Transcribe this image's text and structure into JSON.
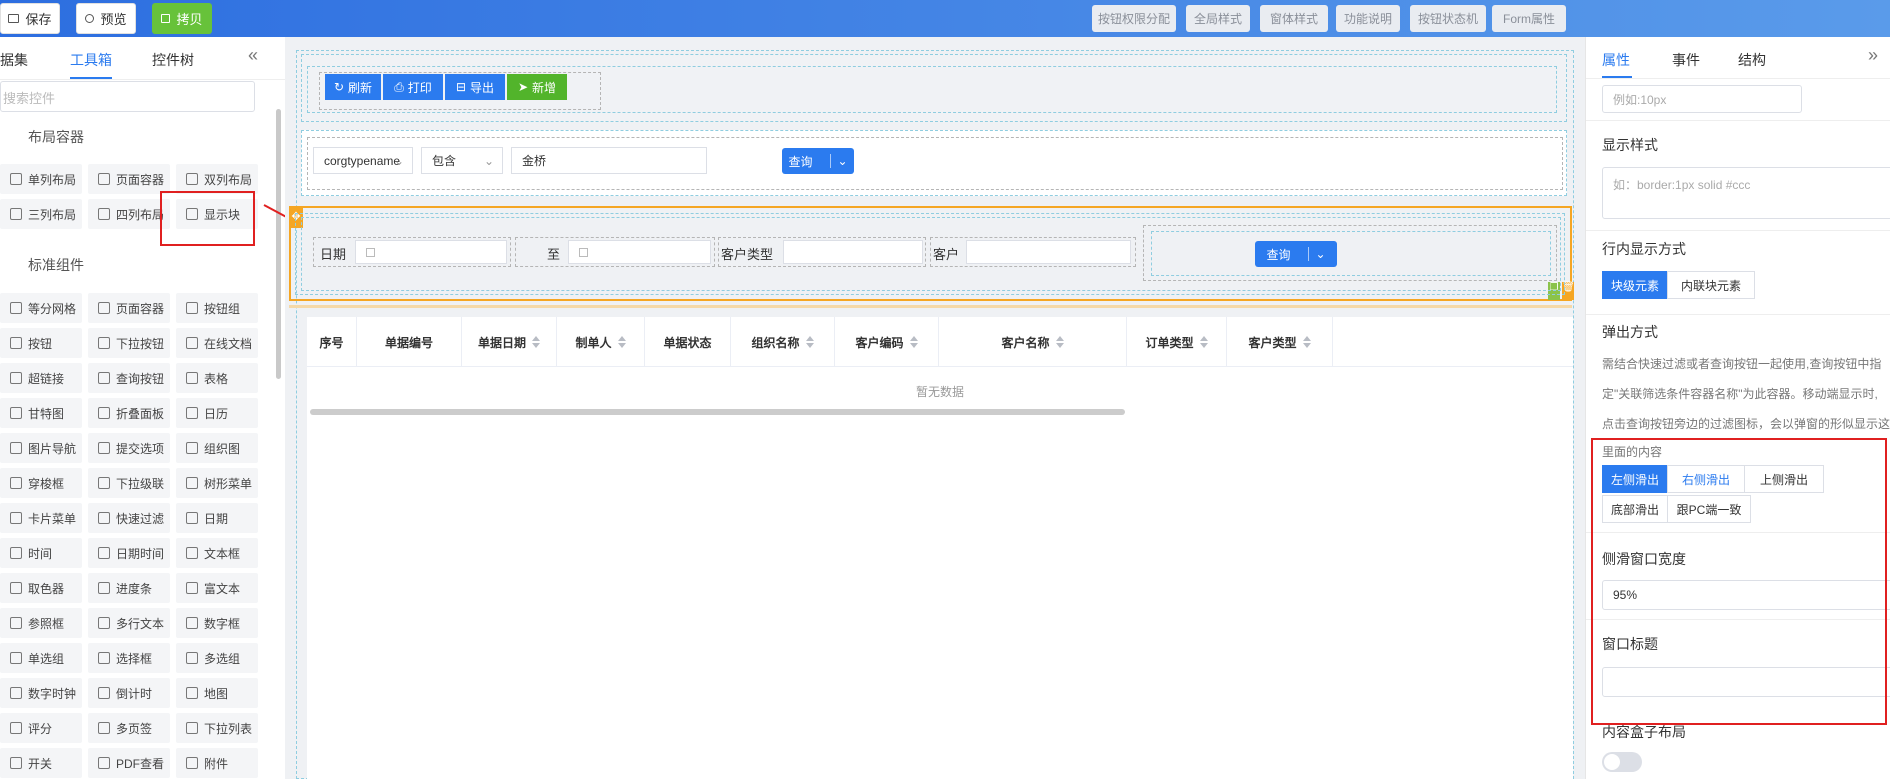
{
  "toolbar": {
    "save": "保存",
    "preview": "预览",
    "copy": "拷贝",
    "right_buttons": [
      "按钮权限分配",
      "全局样式",
      "窗体样式",
      "功能说明",
      "按钮状态机",
      "Form属性"
    ]
  },
  "left_panel": {
    "tabs": [
      "据集",
      "工具箱",
      "控件树"
    ],
    "collapse_icon": "«",
    "search_placeholder": "搜索控件",
    "layout_section": "布局容器",
    "layout_items": [
      "单列布局",
      "页面容器",
      "双列布局",
      "三列布局",
      "四列布局",
      "显示块"
    ],
    "standard_section": "标准组件",
    "standard_items": [
      "等分网格",
      "页面容器",
      "按钮组",
      "按钮",
      "下拉按钮",
      "在线文档",
      "超链接",
      "查询按钮",
      "表格",
      "甘特图",
      "折叠面板",
      "日历",
      "图片导航",
      "提交选项",
      "组织图",
      "穿梭框",
      "下拉级联",
      "树形菜单",
      "卡片菜单",
      "快速过滤",
      "日期",
      "时间",
      "日期时间",
      "文本框",
      "取色器",
      "进度条",
      "富文本",
      "参照框",
      "多行文本",
      "数字框",
      "单选组",
      "选择框",
      "多选组",
      "数字时钟",
      "倒计时",
      "地图",
      "评分",
      "多页签",
      "下拉列表",
      "开关",
      "PDF查看",
      "附件"
    ]
  },
  "canvas": {
    "action_buttons": [
      "刷新",
      "打印",
      "导出",
      "新增"
    ],
    "filter": {
      "field": "corgtypename",
      "operator": "包含",
      "value": "金桥",
      "query": "查询"
    },
    "query_bar": {
      "date_label": "日期",
      "to_label": "至",
      "customer_type_label": "客户类型",
      "customer_label": "客户",
      "query": "查询"
    },
    "table": {
      "columns": [
        "序号",
        "单据编号",
        "单据日期",
        "制单人",
        "单据状态",
        "组织名称",
        "客户编码",
        "客户名称",
        "订单类型",
        "客户类型"
      ],
      "empty_text": "暂无数据"
    }
  },
  "right_panel": {
    "tabs": [
      "属性",
      "事件",
      "结构"
    ],
    "expand_icon": "»",
    "padding_placeholder": "例如:10px",
    "display_style_title": "显示样式",
    "display_style_placeholder": "如：border:1px solid #ccc",
    "inline_title": "行内显示方式",
    "inline_options": [
      "块级元素",
      "内联块元素"
    ],
    "popup_title": "弹出方式",
    "popup_hint_lines": [
      "需结合快速过滤或者查询按钮一起使用,查询按钮中指",
      "定\"关联筛选条件容器名称\"为此容器。移动端显示时,",
      "点击查询按钮旁边的过滤图标，会以弹窗的形似显示这",
      "里面的内容"
    ],
    "slide_options": [
      "左侧滑出",
      "右侧滑出",
      "上侧滑出",
      "底部滑出",
      "跟PC端一致"
    ],
    "slide_width_title": "侧滑窗口宽度",
    "slide_width_value": "95%",
    "window_title_label": "窗口标题",
    "window_title_value": "",
    "flex_title": "内容盒子布局"
  }
}
